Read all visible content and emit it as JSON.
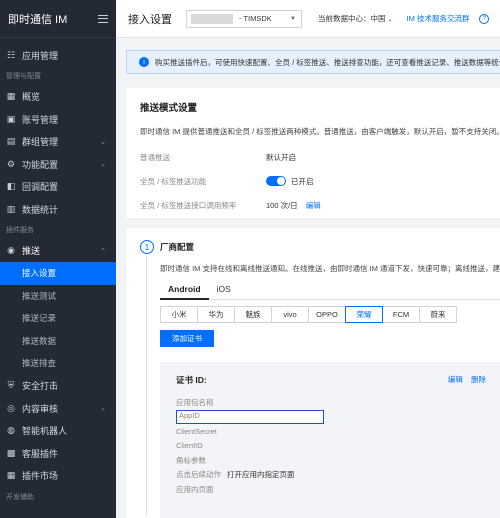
{
  "sidebar": {
    "brand": "即时通信 IM",
    "items_top": [
      {
        "icon": "app-grid-icon",
        "label": "应用管理"
      }
    ],
    "group_manage": "管理与配置",
    "items_manage": [
      {
        "icon": "overview-icon",
        "label": "概览"
      },
      {
        "icon": "account-icon",
        "label": "账号管理"
      },
      {
        "icon": "group-icon",
        "label": "群组管理",
        "chevron": "⌄"
      },
      {
        "icon": "config-icon",
        "label": "功能配置",
        "chevron": "⌄"
      },
      {
        "icon": "callback-icon",
        "label": "回调配置"
      },
      {
        "icon": "stats-icon",
        "label": "数据统计"
      }
    ],
    "group_plugins": "插件服务",
    "push": {
      "icon": "push-icon",
      "label": "推送",
      "chevron": "⌃"
    },
    "push_subitems": [
      "接入设置",
      "推送测试",
      "推送记录",
      "推送数据",
      "推送排查"
    ],
    "items_plugins": [
      {
        "icon": "shield-icon",
        "label": "安全打击"
      },
      {
        "icon": "review-icon",
        "label": "内容审核",
        "chevron": "⌄"
      },
      {
        "icon": "robot-icon",
        "label": "智能机器人"
      },
      {
        "icon": "service-icon",
        "label": "客服插件"
      },
      {
        "icon": "market-icon",
        "label": "插件市场"
      }
    ],
    "group_dev": "开发辅助"
  },
  "topbar": {
    "title": "接入设置",
    "app_select": "- TIMSDK",
    "center_label": "当前数据中心：中国",
    "forum_link": "IM 技术服务交流群",
    "help_icon": "help-icon"
  },
  "notice": {
    "text": "购买推送插件后，可使用快速配置、全员 / 标签推送、推送排查功能，还可查看推送记录、推送数据等统计信息"
  },
  "mode_card": {
    "title": "推送模式设置",
    "desc": "即时通信 IM 提供普通推送和全员 / 标签推送两种模式。普通推送，由客户端触发，默认开启，暂不支持关闭。若",
    "rows": [
      {
        "key": "普通推送",
        "value": "默认开启"
      },
      {
        "key": "全员 / 标签推送功能",
        "value": "已开启"
      },
      {
        "key": "全员 / 标签推送接口调用频率",
        "value": "100 次/日",
        "action": "编辑"
      }
    ]
  },
  "vendor_card": {
    "step": "1",
    "title": "厂商配置",
    "desc": "即时通信 IM 支持在线和离线推送通知。在线推送，由即时通信 IM 通道下发，快速可靠；离线推送，建议在",
    "tabs": [
      "Android",
      "iOS"
    ],
    "vendors": [
      "小米",
      "华为",
      "魅族",
      "vivo",
      "OPPO",
      "荣耀",
      "FCM",
      "蔚来"
    ],
    "add_button": "添加证书",
    "cert": {
      "title": "证书 ID:",
      "edit": "编辑",
      "delete": "删除",
      "fields": [
        {
          "label": "应用包名称",
          "value": ""
        },
        {
          "label": "AppID",
          "value": ""
        },
        {
          "label": "ClientSecret",
          "value": ""
        },
        {
          "label": "ClientID",
          "value": ""
        },
        {
          "label": "角标参数",
          "value": ""
        },
        {
          "label": "点击后续动作",
          "value": "打开应用内指定页面"
        },
        {
          "label": "应用内页面",
          "value": ""
        }
      ]
    }
  }
}
